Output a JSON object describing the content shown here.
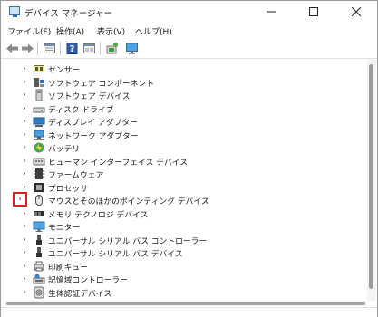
{
  "window": {
    "title": "デバイス マネージャー"
  },
  "title_buttons": {
    "minimize": "–",
    "maximize": "□",
    "close": "✕"
  },
  "menu": [
    {
      "label": "ファイル(F)"
    },
    {
      "label": "操作(A)"
    },
    {
      "label": "表示(V)"
    },
    {
      "label": "ヘルプ(H)"
    }
  ],
  "toolbar": [
    {
      "icon": "back-arrow-icon"
    },
    {
      "icon": "forward-arrow-icon"
    },
    {
      "icon": "properties-icon"
    },
    {
      "icon": "help-icon"
    },
    {
      "icon": "driver-update-icon"
    },
    {
      "icon": "scan-hardware-icon"
    },
    {
      "icon": "monitor-icon"
    }
  ],
  "tree": {
    "expander_glyph": "›",
    "items": [
      {
        "label": "センサー",
        "icon": "sensor-icon"
      },
      {
        "label": "ソフトウェア コンポーネント",
        "icon": "software-component-icon"
      },
      {
        "label": "ソフトウェア デバイス",
        "icon": "software-device-icon"
      },
      {
        "label": "ディスク ドライブ",
        "icon": "disk-drive-icon"
      },
      {
        "label": "ディスプレイ アダプター",
        "icon": "display-adapter-icon"
      },
      {
        "label": "ネットワーク アダプター",
        "icon": "network-adapter-icon"
      },
      {
        "label": "バッテリ",
        "icon": "battery-icon"
      },
      {
        "label": "ヒューマン インターフェイス デバイス",
        "icon": "hid-icon"
      },
      {
        "label": "ファームウェア",
        "icon": "firmware-icon"
      },
      {
        "label": "プロセッサ",
        "icon": "processor-icon"
      },
      {
        "label": "マウスとそのほかのポインティング デバイス",
        "icon": "mouse-icon",
        "highlighted": true
      },
      {
        "label": "メモリ テクノロジ デバイス",
        "icon": "memory-technology-icon"
      },
      {
        "label": "モニター",
        "icon": "monitor-icon"
      },
      {
        "label": "ユニバーサル シリアル バス コントローラー",
        "icon": "usb-controller-icon"
      },
      {
        "label": "ユニバーサル シリアル バス デバイス",
        "icon": "usb-device-icon"
      },
      {
        "label": "印刷キュー",
        "icon": "print-queue-icon"
      },
      {
        "label": "記憶域コントローラー",
        "icon": "storage-controller-icon"
      },
      {
        "label": "生体認証デバイス",
        "icon": "biometric-icon"
      }
    ]
  },
  "colors": {
    "highlight_border": "#e02020",
    "accent": "#1f6fc2"
  }
}
